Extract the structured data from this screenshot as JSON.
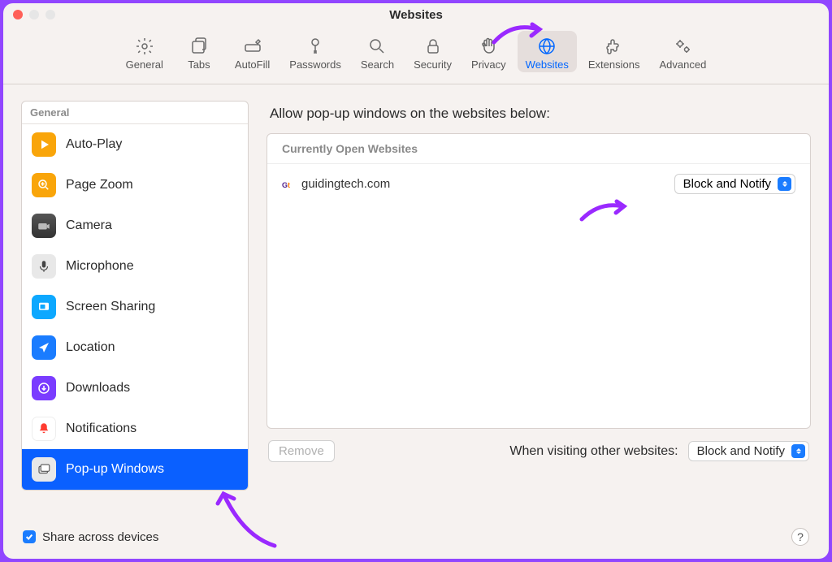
{
  "window": {
    "title": "Websites"
  },
  "toolbar": [
    {
      "id": "general",
      "label": "General"
    },
    {
      "id": "tabs",
      "label": "Tabs"
    },
    {
      "id": "autofill",
      "label": "AutoFill"
    },
    {
      "id": "passwords",
      "label": "Passwords"
    },
    {
      "id": "search",
      "label": "Search"
    },
    {
      "id": "security",
      "label": "Security"
    },
    {
      "id": "privacy",
      "label": "Privacy"
    },
    {
      "id": "websites",
      "label": "Websites",
      "active": true
    },
    {
      "id": "extensions",
      "label": "Extensions"
    },
    {
      "id": "advanced",
      "label": "Advanced"
    }
  ],
  "sidebar": {
    "header": "General",
    "items": [
      {
        "id": "autoplay",
        "label": "Auto-Play"
      },
      {
        "id": "pagezoom",
        "label": "Page Zoom"
      },
      {
        "id": "camera",
        "label": "Camera"
      },
      {
        "id": "microphone",
        "label": "Microphone"
      },
      {
        "id": "screensharing",
        "label": "Screen Sharing"
      },
      {
        "id": "location",
        "label": "Location"
      },
      {
        "id": "downloads",
        "label": "Downloads"
      },
      {
        "id": "notifications",
        "label": "Notifications"
      },
      {
        "id": "popups",
        "label": "Pop-up Windows",
        "selected": true
      }
    ]
  },
  "main": {
    "heading": "Allow pop-up windows on the websites below:",
    "open_header": "Currently Open Websites",
    "sites": [
      {
        "domain": "guidingtech.com",
        "policy": "Block and Notify"
      }
    ],
    "remove_label": "Remove",
    "other_label": "When visiting other websites:",
    "other_policy": "Block and Notify"
  },
  "footer": {
    "share_label": "Share across devices",
    "share_checked": true
  }
}
